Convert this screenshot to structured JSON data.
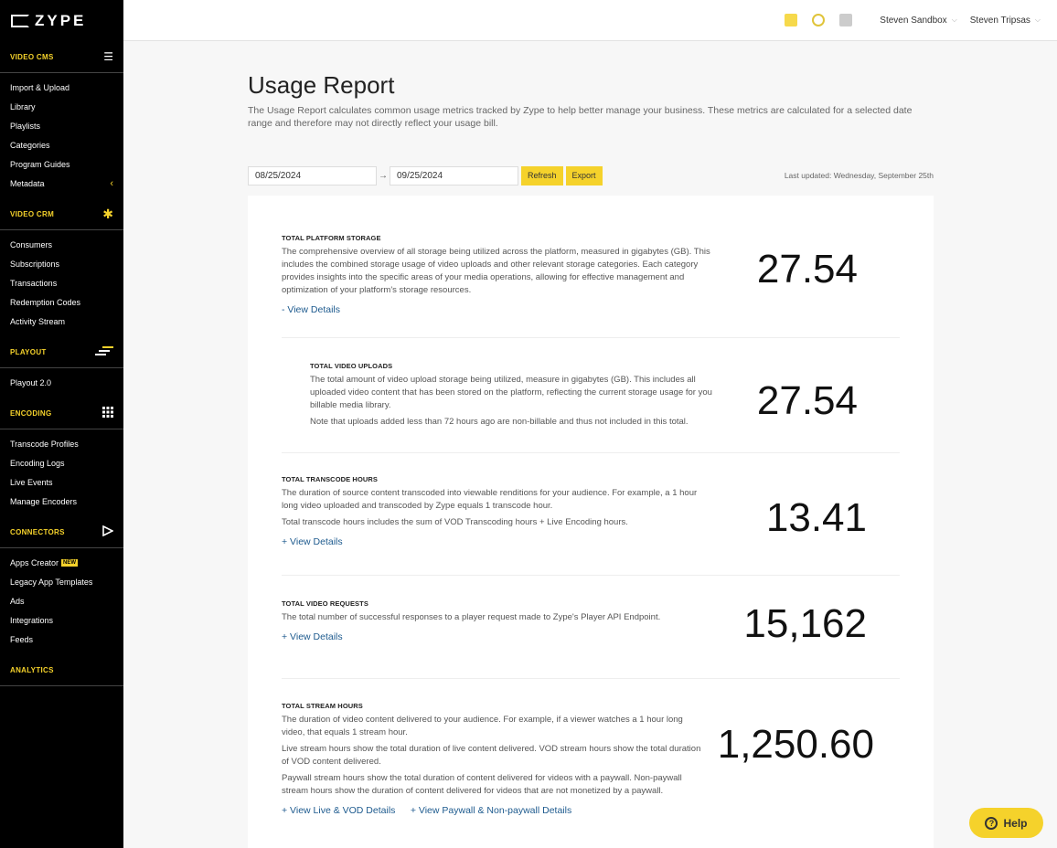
{
  "brand": {
    "logo_text": "ZYPE"
  },
  "sidebar": {
    "sections": [
      {
        "title": "VIDEO CMS",
        "icon": "hamburger-icon",
        "items": [
          "Import & Upload",
          "Library",
          "Playlists",
          "Categories",
          "Program Guides",
          "Metadata"
        ]
      },
      {
        "title": "VIDEO CRM",
        "icon": "asterisk-icon",
        "items": [
          "Consumers",
          "Subscriptions",
          "Transactions",
          "Redemption Codes",
          "Activity Stream"
        ]
      },
      {
        "title": "PLAYOUT",
        "icon": "bars-icon",
        "items": [
          "Playout 2.0"
        ]
      },
      {
        "title": "ENCODING",
        "icon": "grid-icon",
        "items": [
          "Transcode Profiles",
          "Encoding Logs",
          "Live Events",
          "Manage Encoders"
        ]
      },
      {
        "title": "CONNECTORS",
        "icon": "play-icon",
        "items": [
          "Apps Creator",
          "Legacy App Templates",
          "Ads",
          "Integrations",
          "Feeds"
        ]
      },
      {
        "title": "ANALYTICS",
        "icon": "",
        "items": []
      }
    ],
    "new_badge": "NEW"
  },
  "topbar": {
    "account": "Steven Sandbox",
    "user": "Steven Tripsas"
  },
  "page": {
    "title": "Usage Report",
    "description": "The Usage Report calculates common usage metrics tracked by Zype to help better manage your business. These metrics are calculated for a selected date range and therefore may not directly reflect your usage bill."
  },
  "controls": {
    "start_date": "08/25/2024",
    "end_date": "09/25/2024",
    "arrow": "→",
    "refresh_label": "Refresh",
    "export_label": "Export",
    "last_updated": "Last updated: Wednesday, September 25th"
  },
  "metrics": {
    "storage": {
      "title": "TOTAL PLATFORM STORAGE",
      "desc": "The comprehensive overview of all storage being utilized across the platform, measured in gigabytes (GB). This includes the combined storage usage of video uploads and other relevant storage categories. Each category provides insights into the specific areas of your media operations, allowing for effective management and optimization of your platform's storage resources.",
      "link": "- View Details",
      "value": "27.54"
    },
    "uploads": {
      "title": "TOTAL VIDEO UPLOADS",
      "desc": "The total amount of video upload storage being utilized, measure in gigabytes (GB). This includes all uploaded video content that has been stored on the platform, reflecting the current storage usage for you billable media library.",
      "note": "Note that uploads added less than 72 hours ago are non-billable and thus not included in this total.",
      "value": "27.54"
    },
    "transcode": {
      "title": "TOTAL TRANSCODE HOURS",
      "desc": "The duration of source content transcoded into viewable renditions for your audience. For example, a 1 hour long video uploaded and transcoded by Zype equals 1 transcode hour.",
      "note": "Total transcode hours includes the sum of VOD Transcoding hours + Live Encoding hours.",
      "link": "+ View Details",
      "value": "13.41"
    },
    "requests": {
      "title": "TOTAL VIDEO REQUESTS",
      "desc": "The total number of successful responses to a player request made to Zype's Player API Endpoint.",
      "link": "+ View Details",
      "value": "15,162"
    },
    "stream": {
      "title": "TOTAL STREAM HOURS",
      "desc": "The duration of video content delivered to your audience. For example, if a viewer watches a 1 hour long video, that equals 1 stream hour.",
      "note1": "Live stream hours show the total duration of live content delivered. VOD stream hours show the total duration of VOD content delivered.",
      "note2": "Paywall stream hours show the total duration of content delivered for videos with a paywall. Non-paywall stream hours show the duration of content delivered for videos that are not monetized by a paywall.",
      "link1": "+ View Live & VOD Details",
      "link2": "+ View Paywall & Non-paywall Details",
      "value": "1,250.60"
    }
  },
  "help": {
    "label": "Help",
    "icon": "question-icon"
  }
}
